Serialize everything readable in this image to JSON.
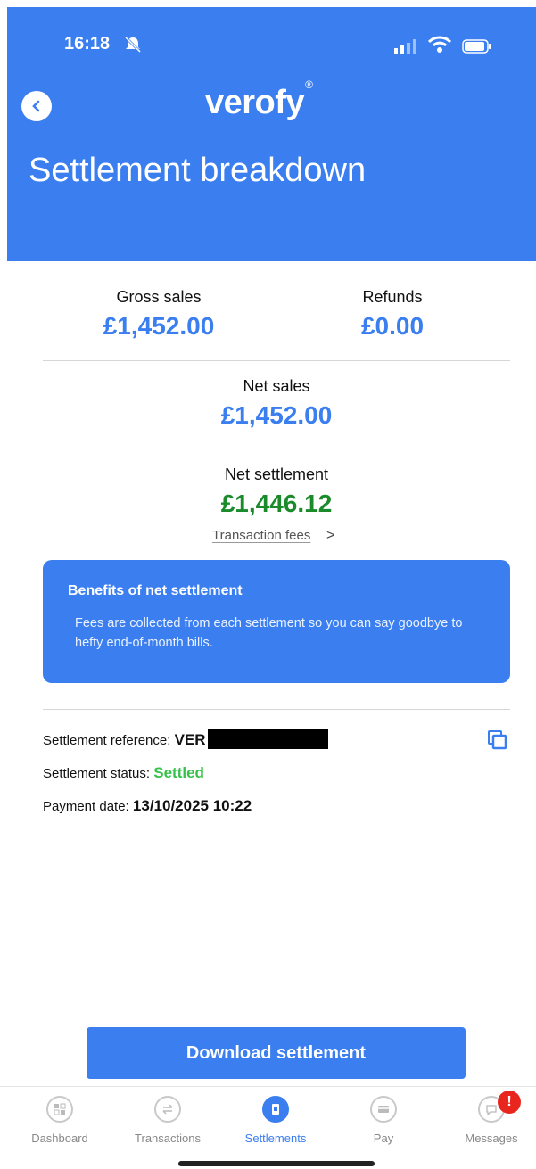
{
  "status_bar": {
    "time": "16:18"
  },
  "header": {
    "logo": "verofy",
    "logo_mark": "®",
    "title": "Settlement breakdown"
  },
  "summary": {
    "gross_sales_label": "Gross sales",
    "gross_sales_value": "£1,452.00",
    "refunds_label": "Refunds",
    "refunds_value": "£0.00",
    "net_sales_label": "Net sales",
    "net_sales_value": "£1,452.00",
    "net_settlement_label": "Net settlement",
    "net_settlement_value": "£1,446.12",
    "transaction_fees_link": "Transaction fees",
    "chevron": ">"
  },
  "info_card": {
    "title": "Benefits of net settlement",
    "body": "Fees are collected from each settlement so you can say goodbye to hefty end-of-month bills."
  },
  "details": {
    "reference_label": "Settlement reference:",
    "reference_value": "VER",
    "status_label": "Settlement status:",
    "status_value": "Settled",
    "payment_date_label": "Payment date:",
    "payment_date_value": "13/10/2025 10:22"
  },
  "actions": {
    "download_label": "Download settlement"
  },
  "tabbar": {
    "tabs": [
      {
        "label": "Dashboard",
        "icon": "dashboard-icon"
      },
      {
        "label": "Transactions",
        "icon": "transactions-icon"
      },
      {
        "label": "Settlements",
        "icon": "settlements-icon",
        "active": true
      },
      {
        "label": "Pay",
        "icon": "pay-icon"
      },
      {
        "label": "Messages",
        "icon": "messages-icon"
      }
    ],
    "messages_badge": "!"
  },
  "colors": {
    "brand_blue": "#3a7eef",
    "settled_green": "#36c24a",
    "net_settlement_green": "#1a8a2a",
    "badge_red": "#e8261e"
  }
}
